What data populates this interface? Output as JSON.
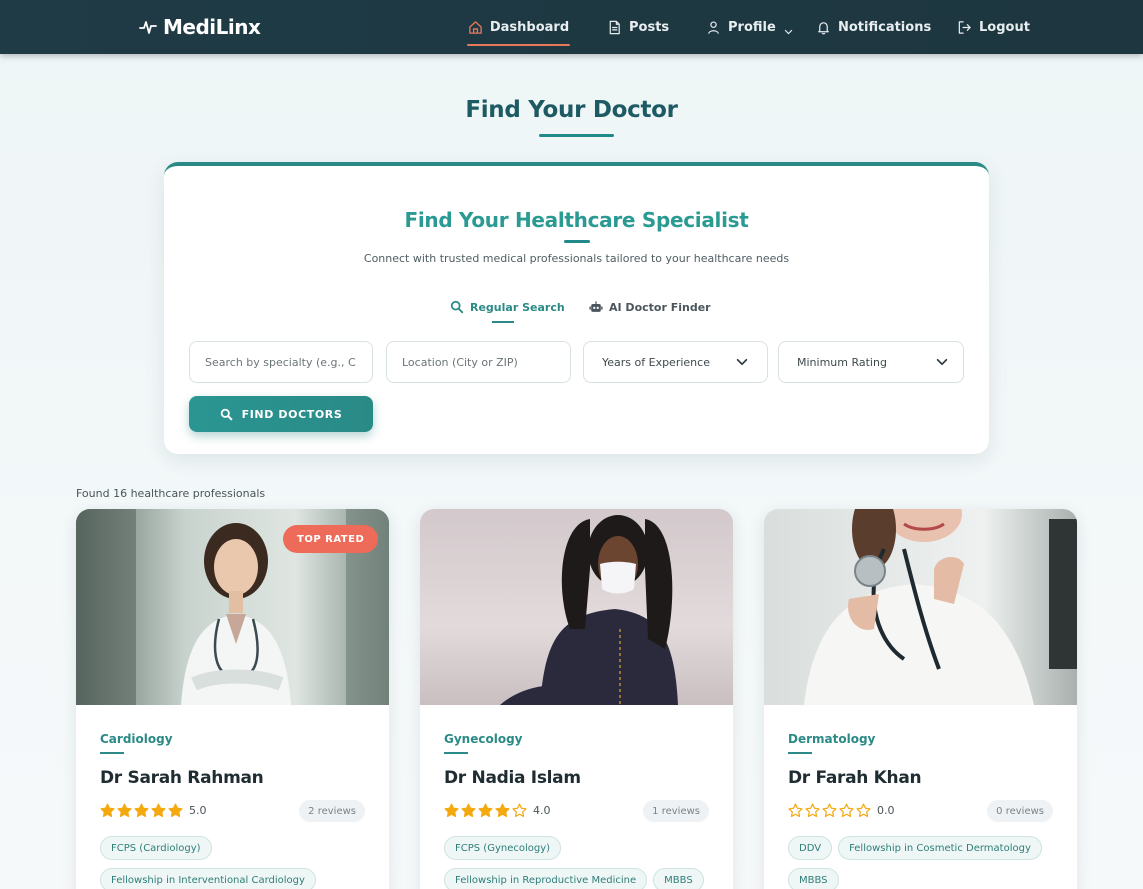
{
  "nav": {
    "brand": "MediLinx",
    "items": [
      {
        "label": "Dashboard",
        "icon": "home-icon",
        "active": true
      },
      {
        "label": "Posts",
        "icon": "document-icon"
      },
      {
        "label": "Profile",
        "icon": "user-icon"
      },
      {
        "label": "Notifications",
        "icon": "bell-icon"
      },
      {
        "label": "Logout",
        "icon": "logout-icon"
      }
    ]
  },
  "page": {
    "title": "Find Your Doctor"
  },
  "search": {
    "heading": "Find Your Healthcare Specialist",
    "subtitle": "Connect with trusted medical professionals tailored to your healthcare needs",
    "tabs": [
      {
        "label": "Regular Search",
        "active": true
      },
      {
        "label": "AI Doctor Finder",
        "active": false
      }
    ],
    "specialty_placeholder": "Search by specialty (e.g., C",
    "location_placeholder": "Location (City or ZIP)",
    "experience_select": "Years of Experience",
    "rating_select": "Minimum Rating",
    "button_label": "FIND DOCTORS"
  },
  "results": {
    "count_text": "Found 16 healthcare professionals",
    "doctors": [
      {
        "specialty": "Cardiology",
        "name": "Dr Sarah Rahman",
        "badge": "TOP RATED",
        "rating": 5,
        "rating_text": "5.0",
        "reviews": "2 reviews",
        "tags": [
          "FCPS (Cardiology)",
          "Fellowship in Interventional Cardiology"
        ]
      },
      {
        "specialty": "Gynecology",
        "name": "Dr Nadia Islam",
        "rating": 4,
        "rating_text": "4.0",
        "reviews": "1 reviews",
        "tags": [
          "FCPS (Gynecology)",
          "Fellowship in Reproductive Medicine",
          "MBBS"
        ]
      },
      {
        "specialty": "Dermatology",
        "name": "Dr Farah Khan",
        "rating": 0,
        "rating_text": "0.0",
        "reviews": "0 reviews",
        "tags": [
          "DDV",
          "Fellowship in Cosmetic Dermatology",
          "MBBS"
        ]
      }
    ]
  },
  "colors": {
    "navbar": "#1f3b45",
    "accent": "#2a8a86",
    "active_underline": "#e8785a",
    "badge": "#ee6b5a",
    "star": "#f4a90f"
  }
}
